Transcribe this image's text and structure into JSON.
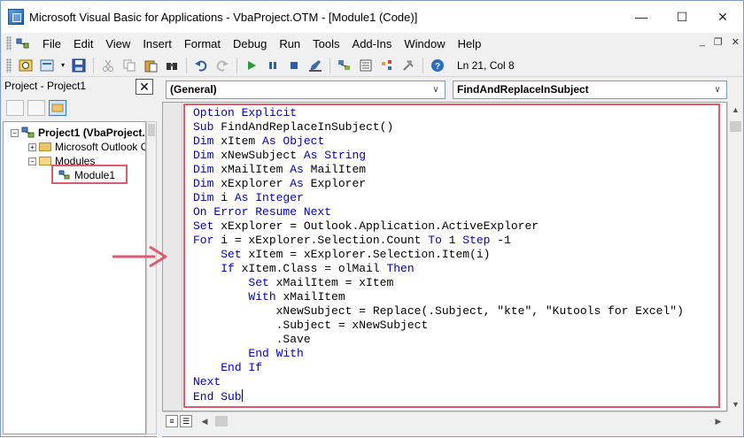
{
  "window": {
    "title": "Microsoft Visual Basic for Applications - VbaProject.OTM - [Module1 (Code)]",
    "controls": {
      "minimize": "—",
      "maximize": "☐",
      "close": "✕"
    }
  },
  "menubar": {
    "items": [
      "File",
      "Edit",
      "View",
      "Insert",
      "Format",
      "Debug",
      "Run",
      "Tools",
      "Add-Ins",
      "Window",
      "Help"
    ],
    "mdi_controls": {
      "minimize": "_",
      "restore": "❐",
      "close": "✕"
    }
  },
  "toolbar": {
    "position": "Ln 21, Col 8"
  },
  "project_panel": {
    "title": "Project - Project1",
    "close": "✕",
    "tree": {
      "project": "Project1 (VbaProject.(",
      "outlook_objects": "Microsoft Outlook Obj",
      "modules_folder": "Modules",
      "module": "Module1"
    }
  },
  "code_window": {
    "object_combo": "(General)",
    "procedure_combo": "FindAndReplaceInSubject",
    "lines": [
      [
        {
          "t": "Option Explicit",
          "k": true
        }
      ],
      [
        {
          "t": "Sub ",
          "k": true
        },
        {
          "t": "FindAndReplaceInSubject()",
          "k": false
        }
      ],
      [
        {
          "t": "Dim ",
          "k": true
        },
        {
          "t": "xItem ",
          "k": false
        },
        {
          "t": "As Object",
          "k": true
        }
      ],
      [
        {
          "t": "Dim ",
          "k": true
        },
        {
          "t": "xNewSubject ",
          "k": false
        },
        {
          "t": "As String",
          "k": true
        }
      ],
      [
        {
          "t": "Dim ",
          "k": true
        },
        {
          "t": "xMailItem ",
          "k": false
        },
        {
          "t": "As ",
          "k": true
        },
        {
          "t": "MailItem",
          "k": false
        }
      ],
      [
        {
          "t": "Dim ",
          "k": true
        },
        {
          "t": "xExplorer ",
          "k": false
        },
        {
          "t": "As ",
          "k": true
        },
        {
          "t": "Explorer",
          "k": false
        }
      ],
      [
        {
          "t": "Dim ",
          "k": true
        },
        {
          "t": "i ",
          "k": false
        },
        {
          "t": "As Integer",
          "k": true
        }
      ],
      [
        {
          "t": "On Error Resume Next",
          "k": true
        }
      ],
      [
        {
          "t": "Set ",
          "k": true
        },
        {
          "t": "xExplorer = Outlook.Application.ActiveExplorer",
          "k": false
        }
      ],
      [
        {
          "t": "For ",
          "k": true
        },
        {
          "t": "i = xExplorer.Selection.Count ",
          "k": false
        },
        {
          "t": "To ",
          "k": true
        },
        {
          "t": "1 ",
          "k": false
        },
        {
          "t": "Step ",
          "k": true
        },
        {
          "t": "-1",
          "k": false
        }
      ],
      [
        {
          "t": "    ",
          "k": false
        },
        {
          "t": "Set ",
          "k": true
        },
        {
          "t": "xItem = xExplorer.Selection.Item(i)",
          "k": false
        }
      ],
      [
        {
          "t": "    ",
          "k": false
        },
        {
          "t": "If ",
          "k": true
        },
        {
          "t": "xItem.Class = olMail ",
          "k": false
        },
        {
          "t": "Then",
          "k": true
        }
      ],
      [
        {
          "t": "        ",
          "k": false
        },
        {
          "t": "Set ",
          "k": true
        },
        {
          "t": "xMailItem = xItem",
          "k": false
        }
      ],
      [
        {
          "t": "        ",
          "k": false
        },
        {
          "t": "With ",
          "k": true
        },
        {
          "t": "xMailItem",
          "k": false
        }
      ],
      [
        {
          "t": "            xNewSubject = Replace(.Subject, \"kte\", \"Kutools for Excel\")",
          "k": false
        }
      ],
      [
        {
          "t": "            .Subject = xNewSubject",
          "k": false
        }
      ],
      [
        {
          "t": "            .Save",
          "k": false
        }
      ],
      [
        {
          "t": "        ",
          "k": false
        },
        {
          "t": "End With",
          "k": true
        }
      ],
      [
        {
          "t": "    ",
          "k": false
        },
        {
          "t": "End If",
          "k": true
        }
      ],
      [
        {
          "t": "Next",
          "k": true
        }
      ],
      [
        {
          "t": "End Sub",
          "k": true
        }
      ]
    ]
  },
  "colors": {
    "keyword": "#0000c0",
    "annotation": "#e05a6e"
  }
}
